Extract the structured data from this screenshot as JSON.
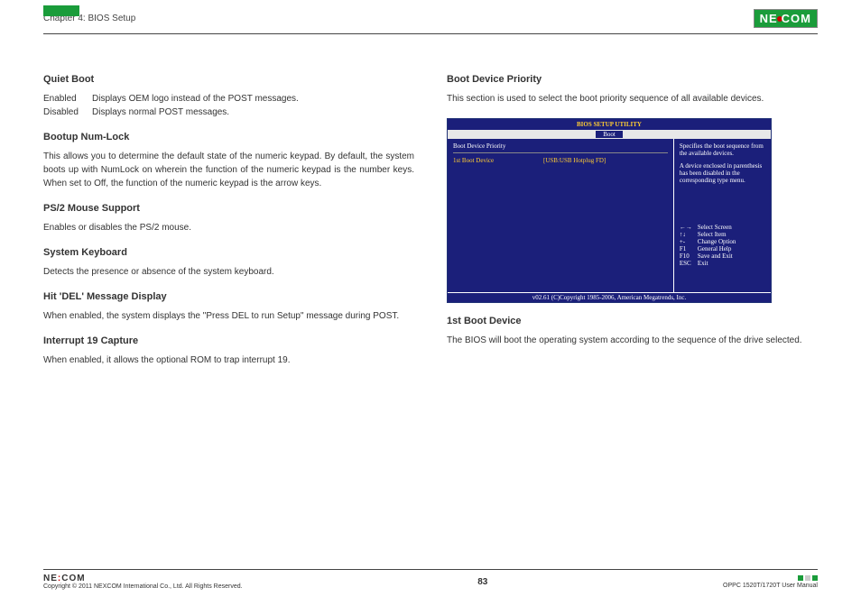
{
  "header": {
    "chapter": "Chapter 4: BIOS Setup",
    "logo": "NEXCOM"
  },
  "left": {
    "s1_title": "Quiet Boot",
    "s1_enabled_label": "Enabled",
    "s1_enabled_text": "Displays OEM logo instead of the POST messages.",
    "s1_disabled_label": "Disabled",
    "s1_disabled_text": "Displays normal POST messages.",
    "s2_title": "Bootup Num-Lock",
    "s2_text": "This allows you to determine the default state of the numeric keypad. By default, the system boots up with NumLock on wherein the function of the numeric keypad is the number keys. When set to Off, the function of the numeric keypad is the arrow keys.",
    "s3_title": "PS/2 Mouse Support",
    "s3_text": "Enables or disables the PS/2 mouse.",
    "s4_title": "System Keyboard",
    "s4_text": "Detects the presence or absence of the system keyboard.",
    "s5_title": "Hit 'DEL' Message Display",
    "s5_text": "When enabled, the system displays the \"Press DEL to run Setup\" message during POST.",
    "s6_title": "Interrupt 19 Capture",
    "s6_text": "When enabled, it allows the optional ROM to trap interrupt 19."
  },
  "right": {
    "s1_title": "Boot Device Priority",
    "s1_text": "This section is used to select the boot priority sequence of all available devices.",
    "s2_title": "1st Boot Device",
    "s2_text": "The BIOS will boot the operating system according to the sequence of the drive selected."
  },
  "bios": {
    "title": "BIOS SETUP UTILITY",
    "tab": "Boot",
    "main_heading": "Boot Device Priority",
    "item_label": "1st Boot Device",
    "item_value": "[USB:USB Hotplug FD]",
    "help1": "Specifies the boot sequence from the available devices.",
    "help2": "A device enclosed in parenthesis has been disabled in the corresponding type menu.",
    "keys": [
      {
        "k": "←→",
        "d": "Select Screen"
      },
      {
        "k": "↑↓",
        "d": "Select Item"
      },
      {
        "k": "+-",
        "d": "Change Option"
      },
      {
        "k": "F1",
        "d": "General Help"
      },
      {
        "k": "F10",
        "d": "Save and Exit"
      },
      {
        "k": "ESC",
        "d": "Exit"
      }
    ],
    "footer": "v02.61 (C)Copyright 1985-2006, American Megatrends, Inc."
  },
  "footer": {
    "logo": "NEXCOM",
    "copyright": "Copyright © 2011 NEXCOM International Co., Ltd. All Rights Reserved.",
    "page": "83",
    "manual": "OPPC 1520T/1720T User Manual"
  }
}
